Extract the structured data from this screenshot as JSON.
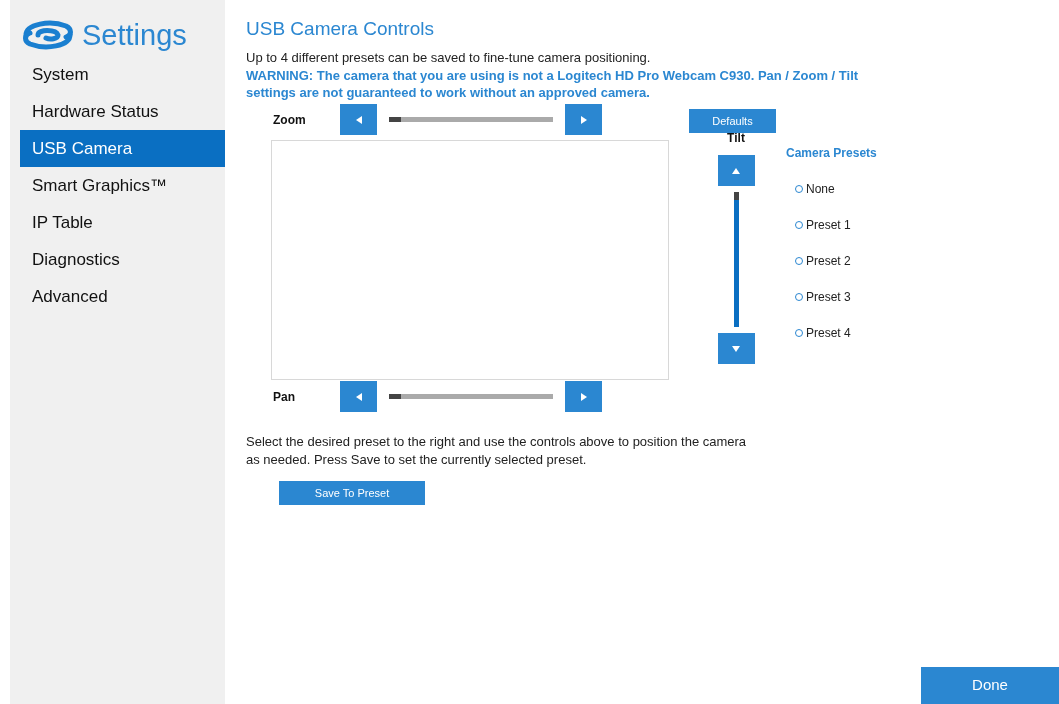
{
  "app_title": "Settings",
  "sidebar": {
    "items": [
      {
        "label": "System",
        "selected": false
      },
      {
        "label": "Hardware Status",
        "selected": false
      },
      {
        "label": "USB Camera",
        "selected": true
      },
      {
        "label": "Smart Graphics™",
        "selected": false
      },
      {
        "label": "IP Table",
        "selected": false
      },
      {
        "label": "Diagnostics",
        "selected": false
      },
      {
        "label": "Advanced",
        "selected": false
      }
    ]
  },
  "page": {
    "title": "USB Camera Controls",
    "intro": "Up to 4 different presets can be saved to fine-tune camera positioning.",
    "warning": "WARNING: The camera that you are using is not a Logitech HD Pro Webcam C930.  Pan / Zoom / Tilt settings are not guaranteed to work without an approved camera.",
    "zoom": {
      "label": "Zoom",
      "level": 0
    },
    "defaults_button": "Defaults",
    "tilt": {
      "label": "Tilt",
      "level": 1
    },
    "pan": {
      "label": "Pan",
      "level": 0
    },
    "presets": {
      "title": "Camera Presets",
      "options": [
        {
          "label": "None",
          "selected": false
        },
        {
          "label": "Preset 1",
          "selected": false
        },
        {
          "label": "Preset 2",
          "selected": false
        },
        {
          "label": "Preset 3",
          "selected": false
        },
        {
          "label": "Preset 4",
          "selected": false
        }
      ]
    },
    "instructions": "Select the desired preset to the right and use the controls above to position the camera as needed.  Press Save to set the currently selected preset.",
    "save_button": "Save To Preset"
  },
  "done_button": "Done"
}
